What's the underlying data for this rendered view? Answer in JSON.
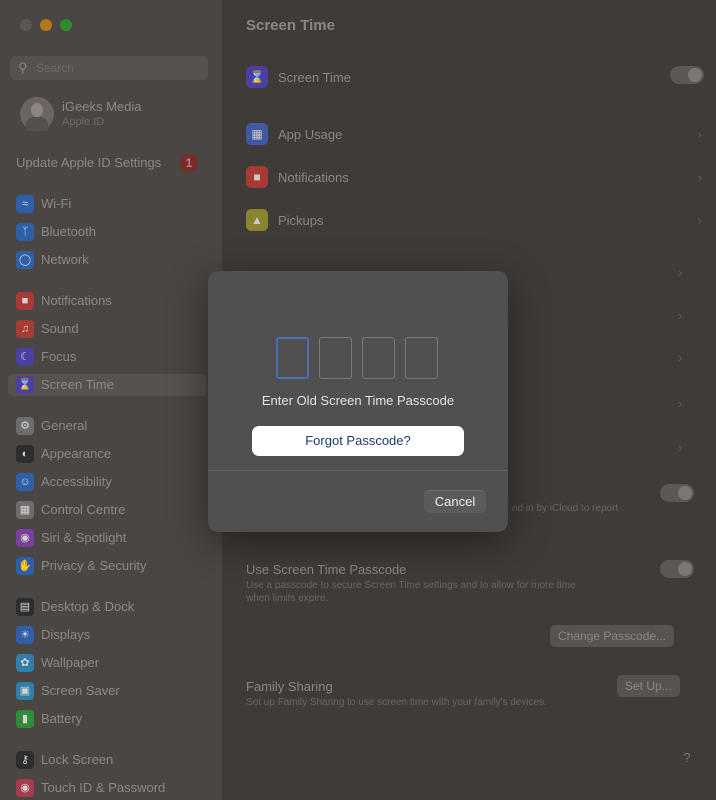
{
  "window": {
    "title": "Screen Time"
  },
  "sidebar": {
    "search_placeholder": "Search",
    "profile": {
      "name": "iGeeks Media",
      "subtitle": "Apple ID"
    },
    "update_label": "Update Apple ID Settings",
    "update_badge": "1",
    "items": [
      {
        "label": "Wi-Fi",
        "icon": "wifi-icon",
        "color": "#2f5fa8"
      },
      {
        "label": "Bluetooth",
        "icon": "bluetooth-icon",
        "color": "#2f5fa8"
      },
      {
        "label": "Network",
        "icon": "globe-icon",
        "color": "#2f5fa8"
      },
      {
        "label": "Notifications",
        "icon": "bell-icon",
        "color": "#a83a35"
      },
      {
        "label": "Sound",
        "icon": "speaker-icon",
        "color": "#a83a35"
      },
      {
        "label": "Focus",
        "icon": "moon-icon",
        "color": "#4b3fa3"
      },
      {
        "label": "Screen Time",
        "icon": "hourglass-icon",
        "color": "#4b3fa3"
      },
      {
        "label": "General",
        "icon": "gear-icon",
        "color": "#6d6d6d"
      },
      {
        "label": "Appearance",
        "icon": "appearance-icon",
        "color": "#2d2d2d"
      },
      {
        "label": "Accessibility",
        "icon": "accessibility-icon",
        "color": "#2f5fa8"
      },
      {
        "label": "Control Centre",
        "icon": "control-centre-icon",
        "color": "#6d6d6d"
      },
      {
        "label": "Siri & Spotlight",
        "icon": "siri-icon",
        "color": "#7a3f9c"
      },
      {
        "label": "Privacy & Security",
        "icon": "hand-icon",
        "color": "#2f5fa8"
      },
      {
        "label": "Desktop & Dock",
        "icon": "dock-icon",
        "color": "#2d2d2d"
      },
      {
        "label": "Displays",
        "icon": "display-icon",
        "color": "#2f5fa8"
      },
      {
        "label": "Wallpaper",
        "icon": "wallpaper-icon",
        "color": "#2f7fa8"
      },
      {
        "label": "Screen Saver",
        "icon": "screensaver-icon",
        "color": "#2f7fa8"
      },
      {
        "label": "Battery",
        "icon": "battery-icon",
        "color": "#2f8a3a"
      },
      {
        "label": "Lock Screen",
        "icon": "lock-icon",
        "color": "#2d2d2d"
      },
      {
        "label": "Touch ID & Password",
        "icon": "fingerprint-icon",
        "color": "#a83a50"
      }
    ]
  },
  "main": {
    "title": "Screen Time",
    "rows": [
      {
        "label": "Screen Time",
        "icon": "hourglass-icon",
        "color": "#4b3fa3"
      },
      {
        "label": "App Usage",
        "icon": "app-usage-icon",
        "color": "#3f5aa3"
      },
      {
        "label": "Notifications",
        "icon": "bell-icon",
        "color": "#a83a35"
      },
      {
        "label": "Pickups",
        "icon": "pickups-icon",
        "color": "#a8a035"
      }
    ],
    "share_sub": "nd in by iCloud to report",
    "passcode_title": "Use Screen Time Passcode",
    "passcode_sub1": "Use a passcode to secure Screen Time settings and to allow for more time",
    "passcode_sub2": "when limits expire.",
    "change_passcode": "Change Passcode...",
    "family_title": "Family Sharing",
    "family_sub": "Set up Family Sharing to use screen time with your family's devices.",
    "setup": "Set Up...",
    "help": "?"
  },
  "modal": {
    "prompt": "Enter Old Screen Time Passcode",
    "forgot_label": "Forgot Passcode?",
    "cancel_label": "Cancel",
    "accent": "#4a6fb5"
  }
}
